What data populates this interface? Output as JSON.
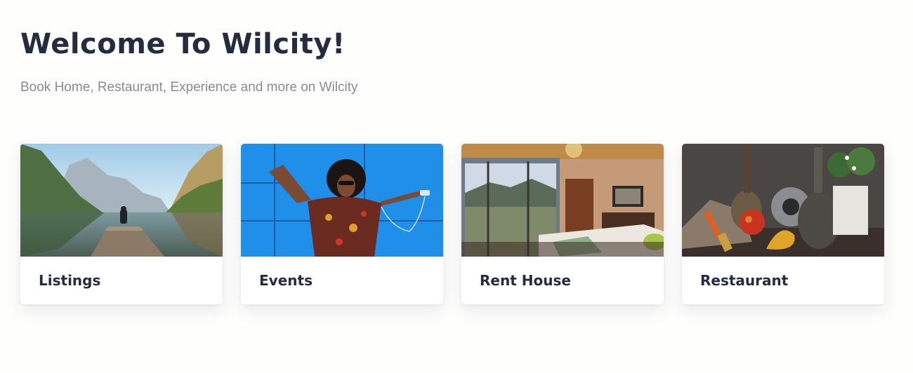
{
  "hero": {
    "title": "Welcome To Wilcity!",
    "subtitle": "Book Home, Restaurant, Experience and more on Wilcity"
  },
  "cards": [
    {
      "label": "Listings",
      "image": "mountain-lake-photo"
    },
    {
      "label": "Events",
      "image": "woman-dancing-blue-wall-photo"
    },
    {
      "label": "Rent House",
      "image": "bedroom-mountain-view-photo"
    },
    {
      "label": "Restaurant",
      "image": "still-life-fruit-bottles-photo"
    }
  ]
}
